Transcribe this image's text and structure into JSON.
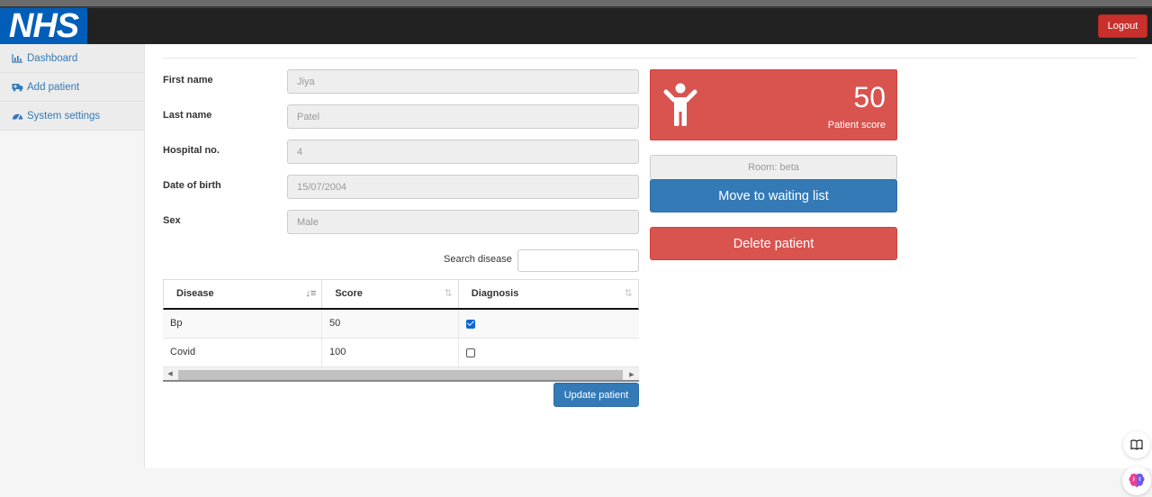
{
  "header": {
    "logo": "NHS",
    "logout_label": "Logout",
    "brand_color": "#005eb8"
  },
  "sidebar": {
    "items": [
      {
        "label": "Dashboard",
        "icon": "bar-chart-icon"
      },
      {
        "label": "Add patient",
        "icon": "ambulance-icon"
      },
      {
        "label": "System settings",
        "icon": "dashboard-gauge-icon"
      }
    ]
  },
  "form": {
    "fields": [
      {
        "label": "First name",
        "value": "Jiya"
      },
      {
        "label": "Last name",
        "value": "Patel"
      },
      {
        "label": "Hospital no.",
        "value": "4"
      },
      {
        "label": "Date of birth",
        "value": "15/07/2004"
      },
      {
        "label": "Sex",
        "value": "Male"
      }
    ]
  },
  "disease_table": {
    "search_label": "Search disease",
    "search_value": "",
    "columns": [
      "Disease",
      "Score",
      "Diagnosis"
    ],
    "rows": [
      {
        "disease": "Bp",
        "score": "50",
        "diagnosis": true
      },
      {
        "disease": "Covid",
        "score": "100",
        "diagnosis": false
      }
    ]
  },
  "update_label": "Update patient",
  "score_panel": {
    "score": "50",
    "label": "Patient score",
    "color": "#d9534f",
    "icon": "child-person-icon"
  },
  "room": "Room: beta",
  "move_label": "Move to waiting list",
  "delete_label": "Delete patient"
}
